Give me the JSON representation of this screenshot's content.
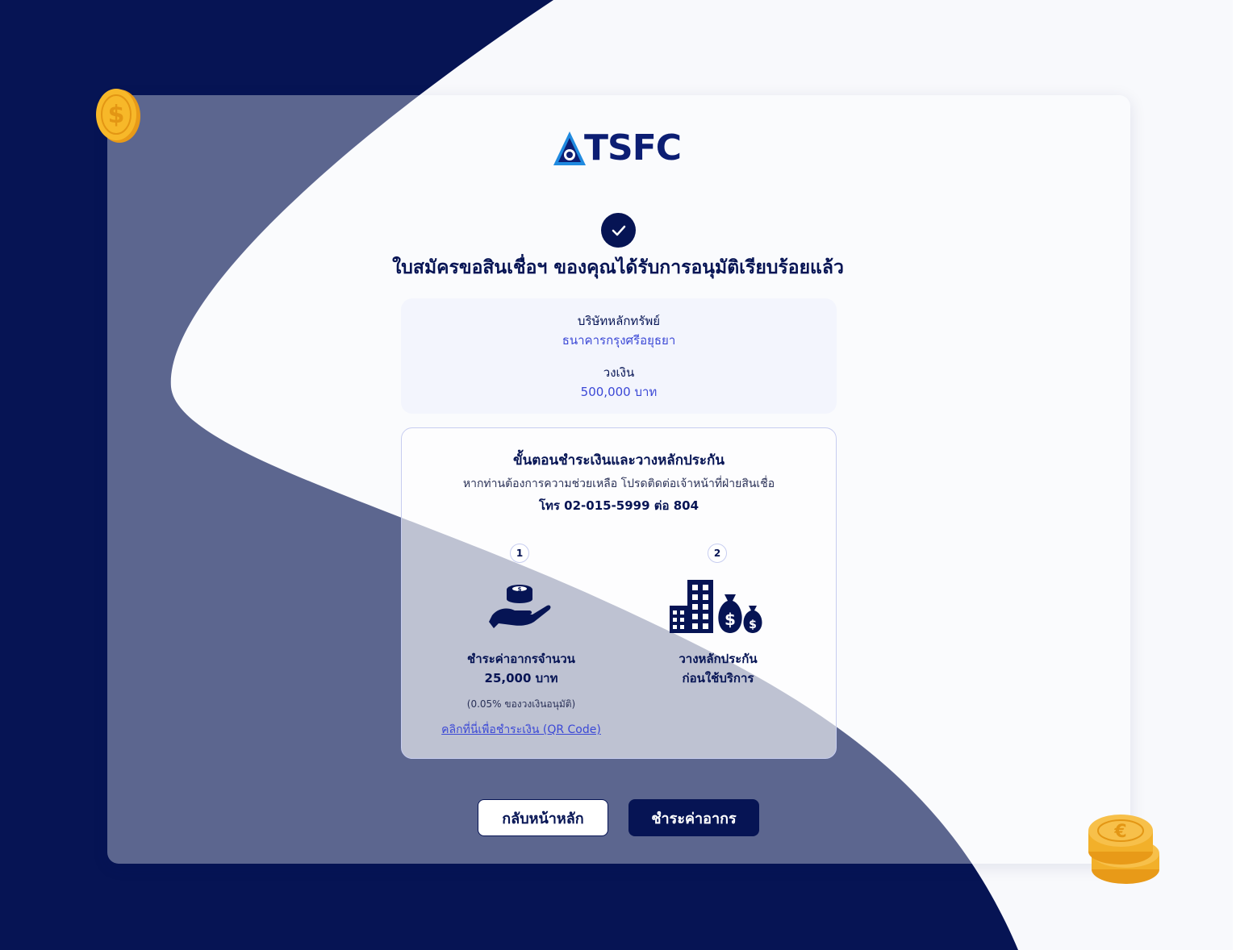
{
  "brand": {
    "logo_text": "TSFC",
    "primary_color": "#061454",
    "accent_color": "#3b48d6"
  },
  "status": {
    "icon": "check-icon",
    "headline": "ใบสมัครขอสินเชื่อฯ ของคุณได้รับการอนุมัติเรียบร้อยแล้ว"
  },
  "summary": {
    "company_label": "บริษัทหลักทรัพย์",
    "company_value": "ธนาคารกรุงศรีอยุธยา",
    "limit_label": "วงเงิน",
    "limit_value": "500,000 บาท"
  },
  "steps": {
    "title": "ขั้นตอนชำระเงินและวางหลักประกัน",
    "help_text": "หากท่านต้องการความช่วยเหลือ โปรดติดต่อเจ้าหน้าที่ฝ่ายสินเชื่อ",
    "phone": "โทร 02-015-5999 ต่อ 804",
    "items": [
      {
        "number": "1",
        "icon": "hand-coins-icon",
        "line1": "ชำระค่าอากรจำนวน",
        "line2": "25,000 บาท",
        "note": "(0.05% ของวงเงินอนุมัติ)",
        "link": "คลิกที่นี่เพื่อชำระเงิน (QR Code)"
      },
      {
        "number": "2",
        "icon": "building-money-bags-icon",
        "line1": "วางหลักประกัน",
        "line2": "ก่อนใช้บริการ"
      }
    ]
  },
  "buttons": {
    "home_label": "กลับหน้าหลัก",
    "pay_label": "ชำระค่าอากร"
  }
}
